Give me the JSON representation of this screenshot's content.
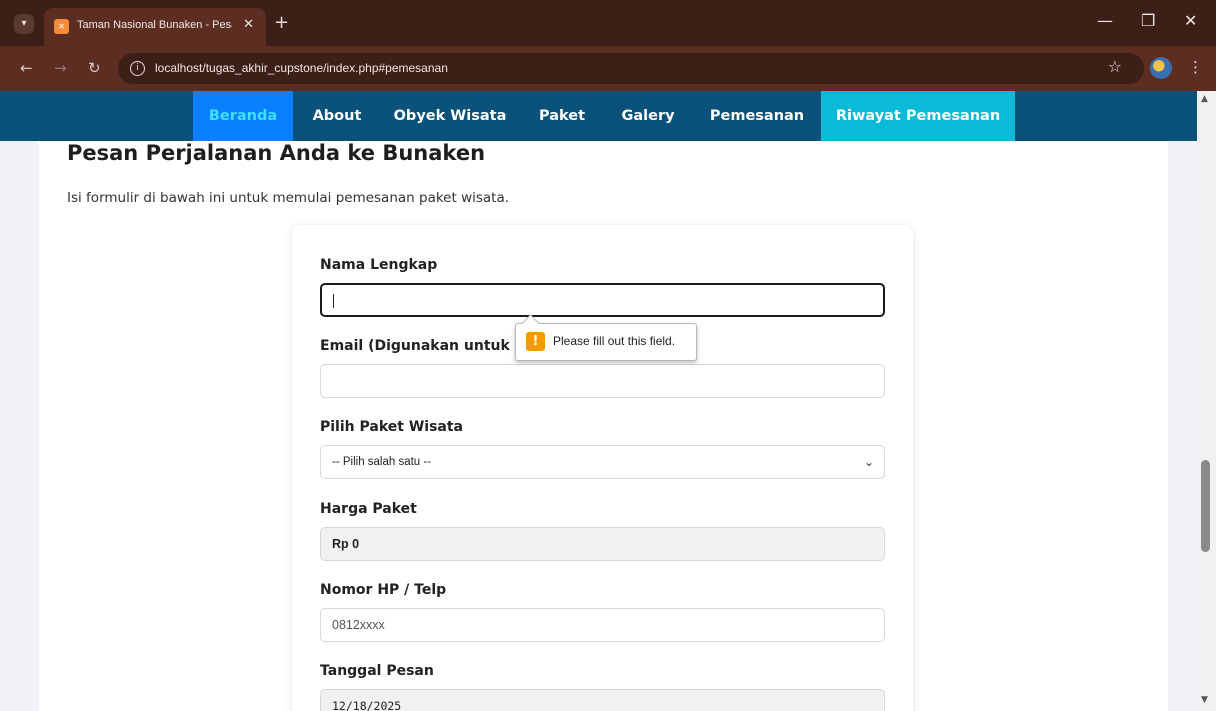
{
  "browser": {
    "tab_title": "Taman Nasional Bunaken - Pesa",
    "tab_close": "✕",
    "new_tab": "+",
    "url": "localhost/tugas_akhir_cupstone/index.php#pemesanan",
    "icons": [
      "tab-search-icon",
      "xampp-favicon-icon",
      "back-icon",
      "forward-icon",
      "reload-icon",
      "info-icon",
      "star-icon",
      "profile-icon",
      "menu-icon",
      "minimize-icon",
      "restore-icon",
      "close-icon"
    ]
  },
  "navbar": {
    "items": [
      "Beranda",
      "About",
      "Obyek Wisata",
      "Paket",
      "Galery",
      "Pemesanan",
      "Riwayat Pemesanan"
    ],
    "active": "Beranda",
    "colors": {
      "bar": "#0a5279",
      "active_bg": "#0a80ff",
      "active_text": "#3fe0ff",
      "highlight_bg": "#0bbad8"
    }
  },
  "section": {
    "title": "Pesan Perjalanan Anda ke Bunaken",
    "subtitle": "Isi formulir di bawah ini untuk memulai pemesanan paket wisata."
  },
  "form": {
    "nama_label": "Nama Lengkap",
    "nama_value": "",
    "email_label": "Email (Digunakan untuk R",
    "email_value": "",
    "paket_label": "Pilih Paket Wisata",
    "paket_selected": "-- Pilih salah satu --",
    "harga_label": "Harga Paket",
    "harga_value": "Rp 0",
    "hp_label": "Nomor HP / Telp",
    "hp_placeholder": "0812xxxx",
    "tanggal_label": "Tanggal Pesan",
    "tanggal_value": "12/18/2025"
  },
  "validation": {
    "message": "Please fill out this field.",
    "icon": "!"
  }
}
